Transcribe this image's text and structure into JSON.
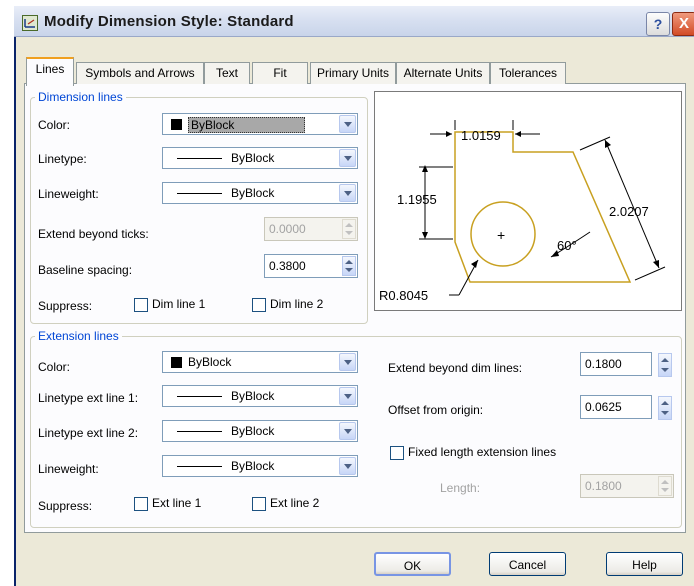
{
  "window": {
    "title": "Modify Dimension Style: Standard",
    "help_glyph": "?",
    "close_glyph": "X",
    "title_icon": "dimension-style-icon"
  },
  "tabs": [
    {
      "label": "Lines",
      "active": true
    },
    {
      "label": "Symbols and Arrows",
      "active": false
    },
    {
      "label": "Text",
      "active": false
    },
    {
      "label": "Fit",
      "active": false
    },
    {
      "label": "Primary Units",
      "active": false
    },
    {
      "label": "Alternate Units",
      "active": false
    },
    {
      "label": "Tolerances",
      "active": false
    }
  ],
  "dimension_lines": {
    "group_label": "Dimension lines",
    "color_label": "Color:",
    "color_value": "ByBlock",
    "linetype_label": "Linetype:",
    "linetype_value": "ByBlock",
    "lineweight_label": "Lineweight:",
    "lineweight_value": "ByBlock",
    "extend_label": "Extend beyond ticks:",
    "extend_value": "0.0000",
    "baseline_label": "Baseline spacing:",
    "baseline_value": "0.3800",
    "suppress_label": "Suppress:",
    "dim_line1_label": "Dim line 1",
    "dim_line2_label": "Dim line 2"
  },
  "extension_lines": {
    "group_label": "Extension lines",
    "color_label": "Color:",
    "color_value": "ByBlock",
    "linetype1_label": "Linetype ext line 1:",
    "linetype1_value": "ByBlock",
    "linetype2_label": "Linetype ext line 2:",
    "linetype2_value": "ByBlock",
    "lineweight_label": "Lineweight:",
    "lineweight_value": "ByBlock",
    "suppress_label": "Suppress:",
    "ext_line1_label": "Ext line 1",
    "ext_line2_label": "Ext line 2",
    "extend_beyond_label": "Extend beyond dim lines:",
    "extend_beyond_value": "0.1800",
    "offset_label": "Offset from origin:",
    "offset_value": "0.0625",
    "fixed_length_label": "Fixed length extension lines",
    "length_label": "Length:",
    "length_value": "0.1800"
  },
  "preview": {
    "dim_top": "1.0159",
    "dim_left": "1.1955",
    "dim_right": "2.0207",
    "angle": "60°",
    "radius": "R0.8045",
    "plus": "+"
  },
  "buttons": {
    "ok": "OK",
    "cancel": "Cancel",
    "help": "Help"
  },
  "colors": {
    "accent": "#0046d5",
    "shape_outline": "#c8a020",
    "tab_highlight": "#f0a020"
  }
}
